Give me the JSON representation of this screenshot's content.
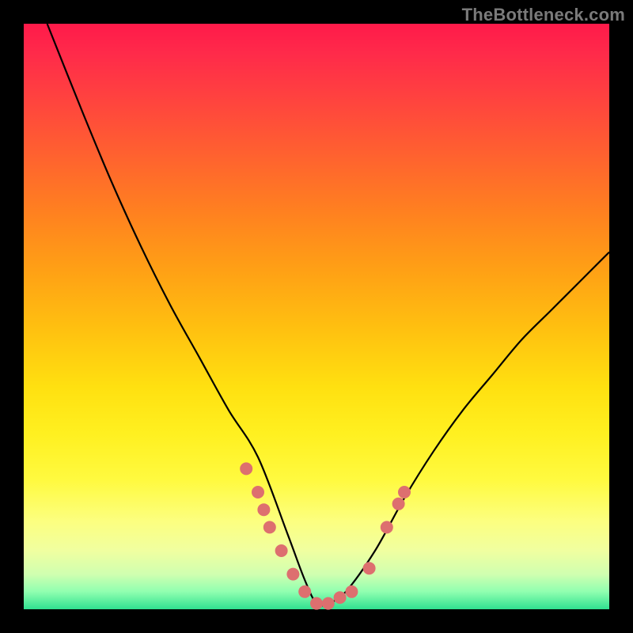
{
  "watermark": "TheBottleneck.com",
  "chart_data": {
    "type": "line",
    "title": "",
    "xlabel": "",
    "ylabel": "",
    "xlim": [
      0,
      100
    ],
    "ylim": [
      0,
      100
    ],
    "grid": false,
    "legend": false,
    "background_gradient": {
      "top": "#ff1a4a",
      "middle": "#ffd010",
      "bottom": "#30e090"
    },
    "series": [
      {
        "name": "bottleneck-curve",
        "color": "#000000",
        "x": [
          4,
          10,
          15,
          20,
          25,
          30,
          35,
          40,
          45,
          48,
          50,
          52,
          55,
          60,
          65,
          70,
          75,
          80,
          85,
          90,
          95,
          100
        ],
        "y": [
          100,
          85,
          73,
          62,
          52,
          43,
          34,
          26,
          13,
          5,
          1,
          1,
          3,
          10,
          19,
          27,
          34,
          40,
          46,
          51,
          56,
          61
        ]
      }
    ],
    "markers": {
      "color": "#dd6f6f",
      "radius_px": 8,
      "points_xy": [
        [
          38,
          24
        ],
        [
          40,
          20
        ],
        [
          41,
          17
        ],
        [
          42,
          14
        ],
        [
          44,
          10
        ],
        [
          46,
          6
        ],
        [
          48,
          3
        ],
        [
          50,
          1
        ],
        [
          52,
          1
        ],
        [
          54,
          2
        ],
        [
          56,
          3
        ],
        [
          59,
          7
        ],
        [
          62,
          14
        ],
        [
          64,
          18
        ],
        [
          65,
          20
        ]
      ]
    }
  }
}
